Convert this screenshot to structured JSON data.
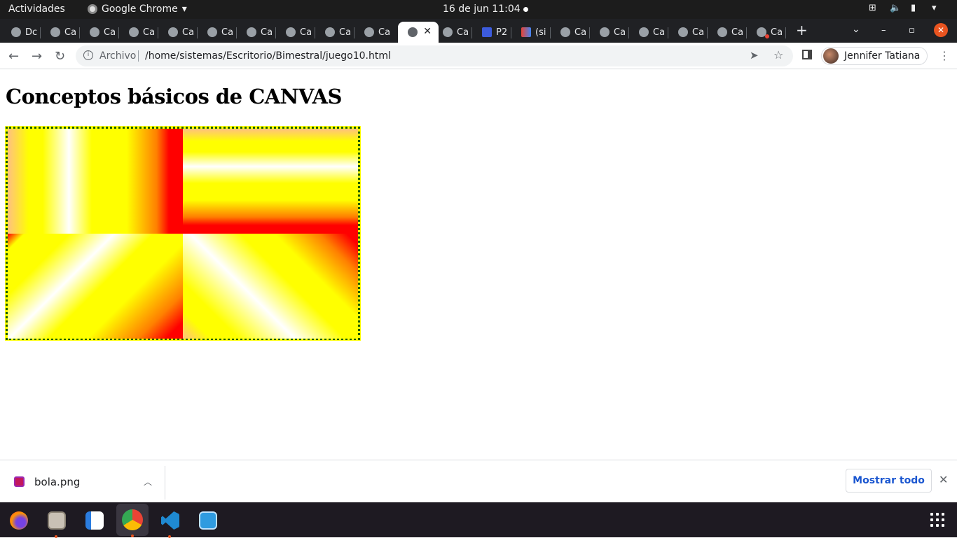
{
  "system_bar": {
    "activities": "Actividades",
    "app_name": "Google Chrome",
    "clock": "16 de jun  11:04"
  },
  "tabs": [
    {
      "label": "Dc"
    },
    {
      "label": "Ca"
    },
    {
      "label": "Ca"
    },
    {
      "label": "Ca"
    },
    {
      "label": "Ca"
    },
    {
      "label": "Ca"
    },
    {
      "label": "Ca"
    },
    {
      "label": "Ca"
    },
    {
      "label": "Ca"
    },
    {
      "label": "Ca"
    },
    {
      "label": ""
    },
    {
      "label": "Ca"
    },
    {
      "label": "P2"
    },
    {
      "label": "(si"
    },
    {
      "label": "Ca"
    },
    {
      "label": "Ca"
    },
    {
      "label": "Ca"
    },
    {
      "label": "Ca"
    },
    {
      "label": "Ca"
    },
    {
      "label": "Ca"
    }
  ],
  "toolbar": {
    "scheme_label": "Archivo",
    "url": "/home/sistemas/Escritorio/Bimestral/juego10.html",
    "profile_name": "Jennifer Tatiana"
  },
  "page": {
    "heading": "Conceptos básicos de CANVAS"
  },
  "downloads": {
    "file_name": "bola.png",
    "show_all": "Mostrar todo"
  },
  "colors": {
    "tabstrip_bg": "#202124",
    "canvas_border": "#1a5e00",
    "gradient_colors": [
      "#ffff00",
      "#ffffff",
      "#ff8000",
      "#ff0000"
    ],
    "dock_bg": "#1e1a22",
    "link_blue": "#1a56d0"
  },
  "dock": {
    "apps": [
      "firefox-icon",
      "files-icon",
      "text-editor-icon",
      "chrome-icon",
      "vscode-icon",
      "system-monitor-icon"
    ]
  }
}
